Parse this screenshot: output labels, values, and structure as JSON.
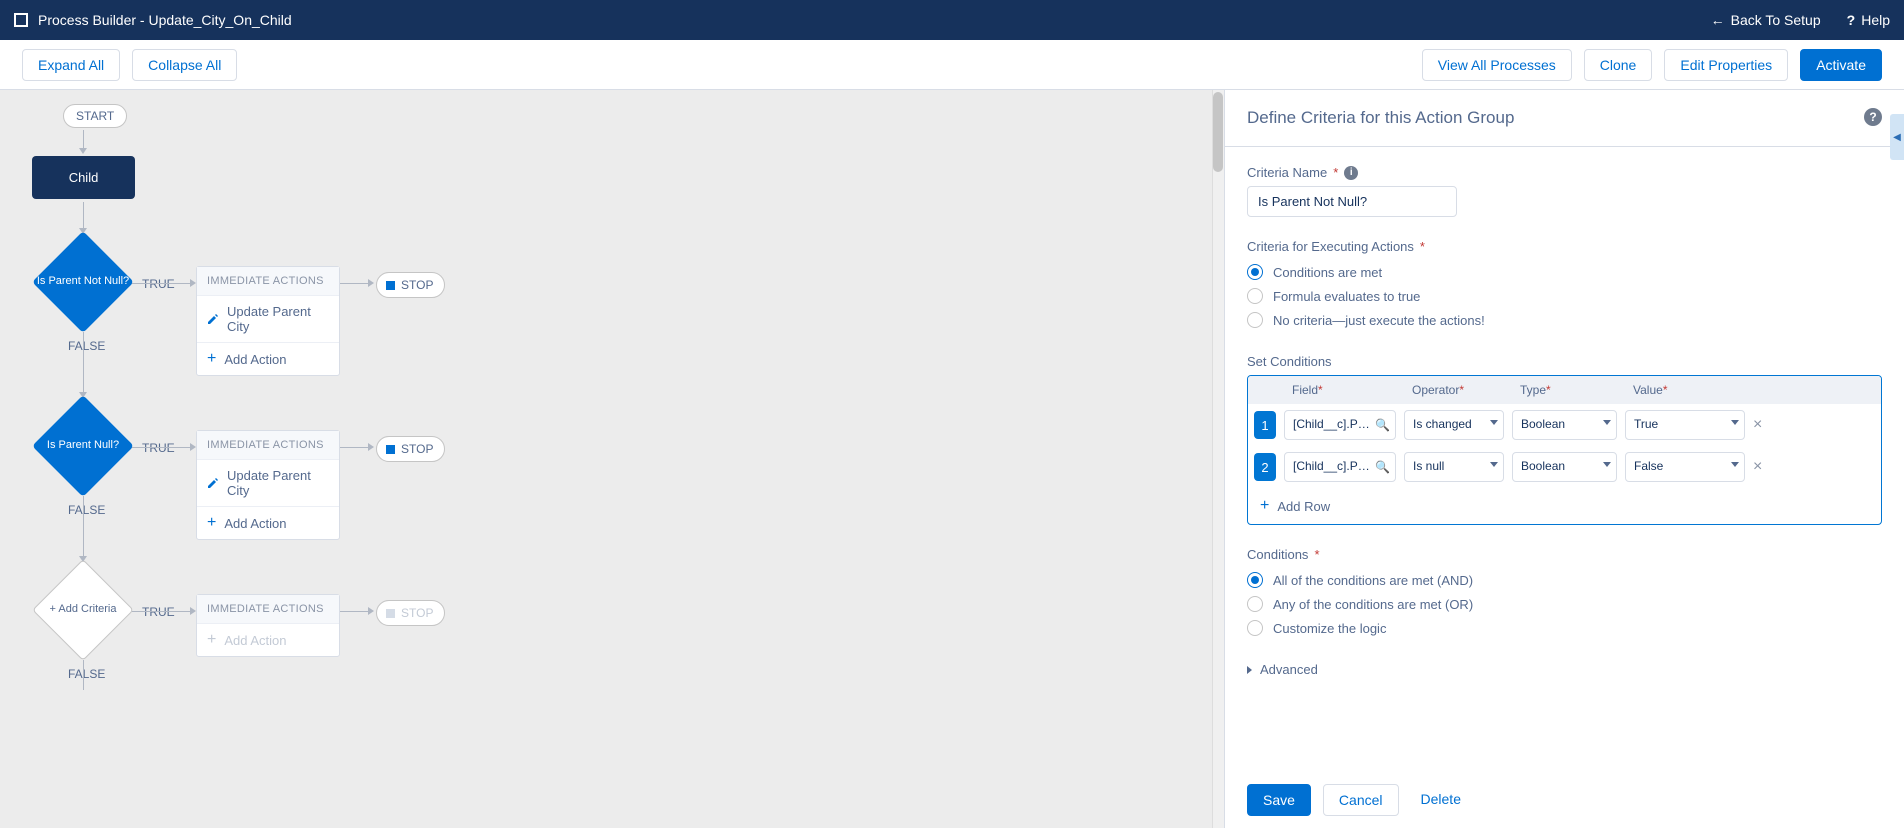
{
  "header": {
    "title": "Process Builder - Update_City_On_Child",
    "back": "Back To Setup",
    "help": "Help"
  },
  "toolbar": {
    "expand": "Expand All",
    "collapse": "Collapse All",
    "viewAll": "View All Processes",
    "clone": "Clone",
    "editProps": "Edit Properties",
    "activate": "Activate"
  },
  "canvas": {
    "start": "START",
    "object": "Child",
    "trueLabel": "TRUE",
    "falseLabel": "FALSE",
    "criteria1": "Is Parent Not Null?",
    "criteria2": "Is Parent Null?",
    "addCriteria": "+ Add Criteria",
    "immediate": "IMMEDIATE ACTIONS",
    "action1": "Update Parent City",
    "addAction": "Add Action",
    "stop": "STOP"
  },
  "panel": {
    "title": "Define Criteria for this Action Group",
    "criteriaNameLabel": "Criteria Name",
    "criteriaNameValue": "Is Parent Not Null?",
    "execLabel": "Criteria for Executing Actions",
    "execOpt1": "Conditions are met",
    "execOpt2": "Formula evaluates to true",
    "execOpt3": "No criteria—just execute the actions!",
    "setCond": "Set Conditions",
    "hField": "Field",
    "hOperator": "Operator",
    "hType": "Type",
    "hValue": "Value",
    "row1": {
      "n": "1",
      "field": "[Child__c].Par...",
      "op": "Is changed",
      "type": "Boolean",
      "val": "True"
    },
    "row2": {
      "n": "2",
      "field": "[Child__c].Par...",
      "op": "Is null",
      "type": "Boolean",
      "val": "False"
    },
    "addRow": "Add Row",
    "condLabel": "Conditions",
    "condOpt1": "All of the conditions are met (AND)",
    "condOpt2": "Any of the conditions are met (OR)",
    "condOpt3": "Customize the logic",
    "advanced": "Advanced",
    "save": "Save",
    "cancel": "Cancel",
    "delete": "Delete"
  }
}
